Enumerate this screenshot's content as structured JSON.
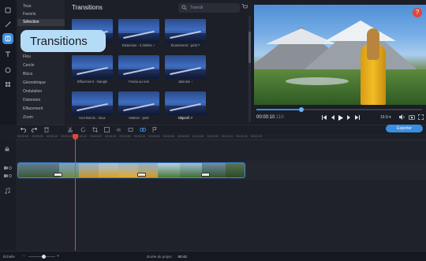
{
  "categories": [
    "Tous",
    "Favoris",
    "Sélection",
    "Flou",
    "Cercle",
    "Blocs",
    "Géométrique",
    "Ondulation",
    "Distorsion",
    "Effacement",
    "Zoom"
  ],
  "selected_category": "Sélection",
  "callout": "Transitions",
  "panel": {
    "title": "Transitions",
    "search_placeholder": "Transiti",
    "tiles": [
      {
        "label": ""
      },
      {
        "label": "Distorsion - 2 étoiles ✓"
      },
      {
        "label": "Écartement - petit ?"
      },
      {
        "label": "Effacement - triangle"
      },
      {
        "label": "Fondu au noir"
      },
      {
        "label": "Jalousie ↓"
      },
      {
        "label": "Kori Bornis - doux"
      },
      {
        "label": "Mattice - petit"
      },
      {
        "label": "Objectif ↗"
      }
    ]
  },
  "player": {
    "time_main": "00:00:10",
    "time_ms": ".110",
    "progress": 0.27,
    "aspect_ratio": "16:9 ▾"
  },
  "export_label": "Exporter",
  "ruler_ticks": [
    "00:00:00",
    "00:00:05",
    "00:00:10",
    "00:00:15",
    "00:00:20",
    "00:00:25",
    "00:00:30",
    "00:00:35",
    "00:00:40",
    "00:00:45",
    "00:00:50",
    "00:00:55",
    "00:01:00",
    "00:01:05",
    "00:01:10",
    "00:01:15",
    "00:01:20"
  ],
  "status": {
    "scale_label": "Échelle",
    "zoom_level": 0.55,
    "duration_label": "Durée du projet :",
    "duration_value": "00:43"
  },
  "colors": {
    "accent": "#3b8de0",
    "playhead": "#e2463b",
    "callout": "#b5dcf7"
  },
  "icons": {
    "rail": [
      "wand-icon",
      "transitions-icon",
      "titles-icon",
      "stickers-icon",
      "more-icon"
    ],
    "toolbar": [
      "undo-icon",
      "redo-icon",
      "delete-icon",
      "cut-icon",
      "rotate-icon",
      "crop-icon",
      "color-icon",
      "audio-icon",
      "stabilize-icon",
      "link-icon",
      "marker-icon"
    ]
  }
}
